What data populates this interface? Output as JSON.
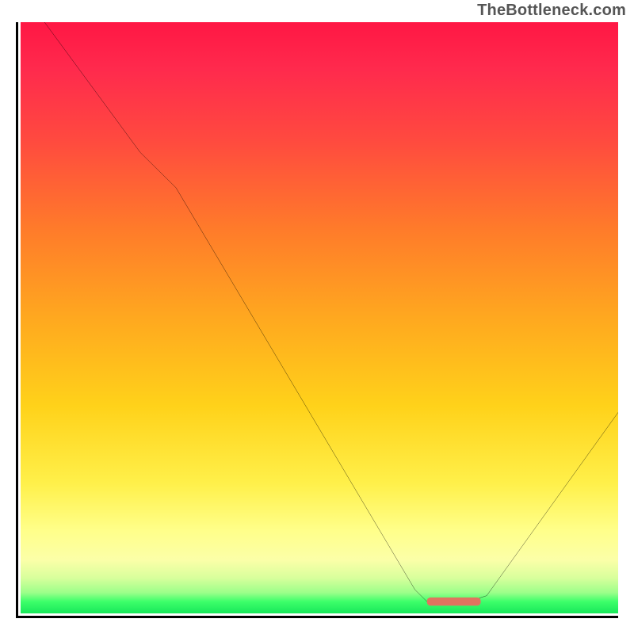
{
  "watermark": "TheBottleneck.com",
  "chart_data": {
    "type": "line",
    "title": "",
    "xlabel": "",
    "ylabel": "",
    "xlim": [
      0,
      100
    ],
    "ylim": [
      0,
      100
    ],
    "series": [
      {
        "name": "bottleneck-curve",
        "x": [
          4,
          20,
          26,
          66,
          68,
          75,
          78,
          100
        ],
        "values": [
          100,
          78,
          72,
          4,
          2,
          2,
          3,
          34
        ]
      }
    ],
    "marker": {
      "name": "optimal-range",
      "x_start": 68,
      "x_end": 77,
      "y": 2,
      "color": "#e0745f"
    },
    "background_gradient": {
      "orientation": "vertical",
      "stops": [
        {
          "pos": 0,
          "color": "#ff1744"
        },
        {
          "pos": 0.35,
          "color": "#ff7b2a"
        },
        {
          "pos": 0.65,
          "color": "#ffd21a"
        },
        {
          "pos": 0.86,
          "color": "#ffff8a"
        },
        {
          "pos": 0.96,
          "color": "#9cff8a"
        },
        {
          "pos": 1.0,
          "color": "#18e85a"
        }
      ]
    }
  }
}
